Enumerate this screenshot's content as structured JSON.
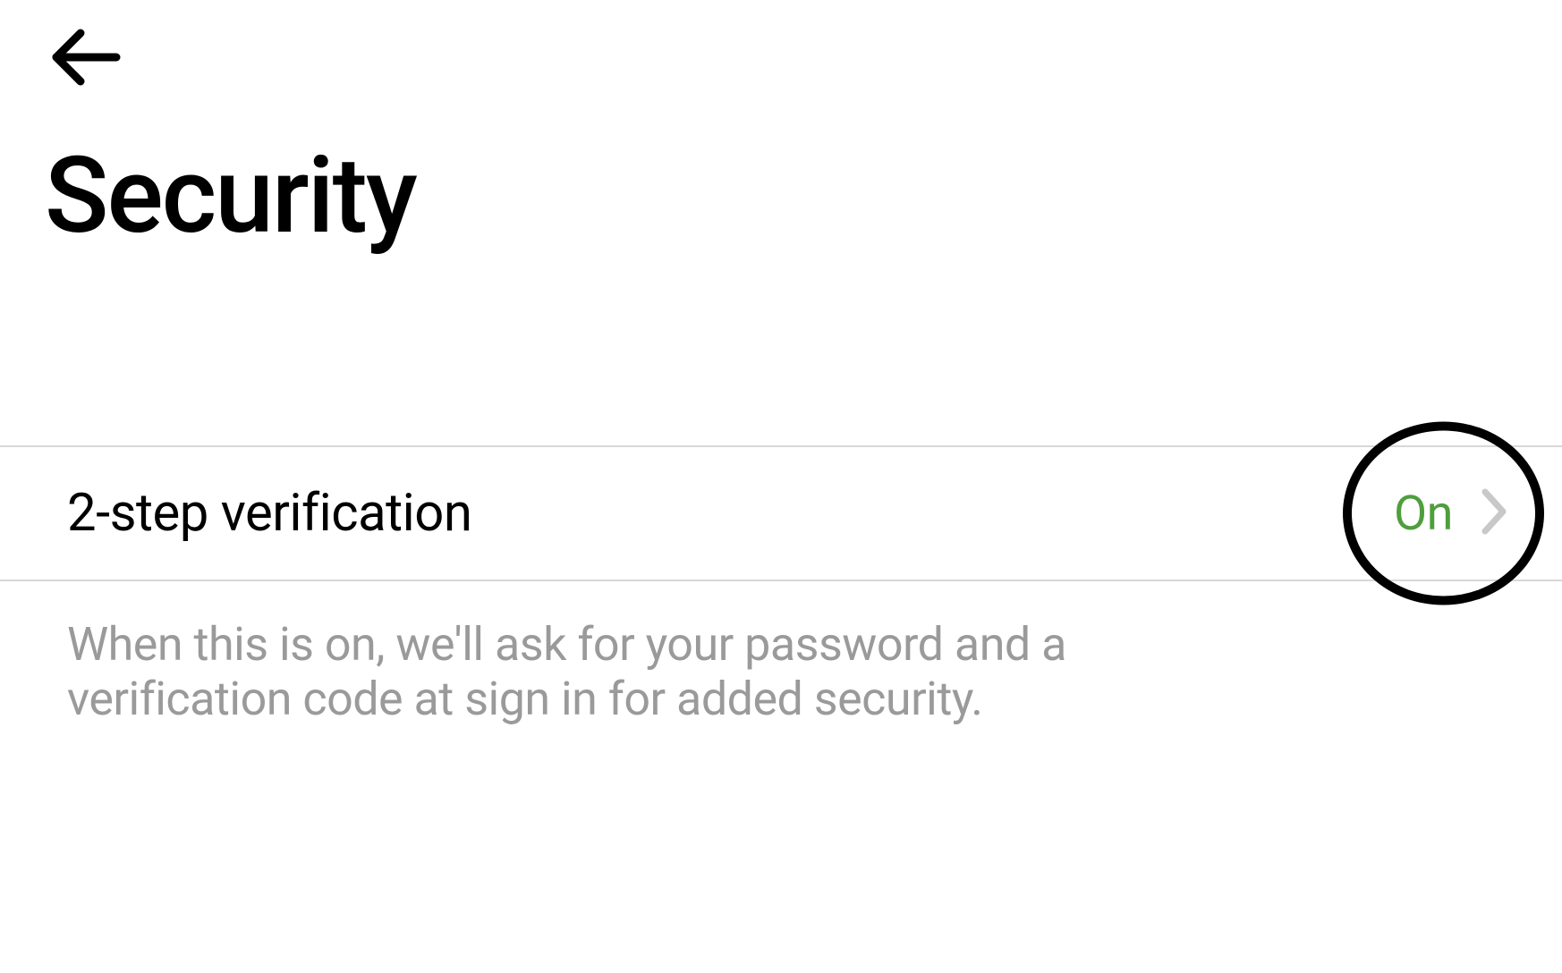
{
  "header": {
    "title": "Security"
  },
  "settings": {
    "two_step": {
      "label": "2-step verification",
      "status": "On",
      "description": "When this is on, we'll ask for your password and a verification code at sign in for added security."
    }
  },
  "colors": {
    "status_on": "#4f9e3e",
    "text_muted": "#9a9a9a",
    "divider": "#d8d8d8"
  }
}
